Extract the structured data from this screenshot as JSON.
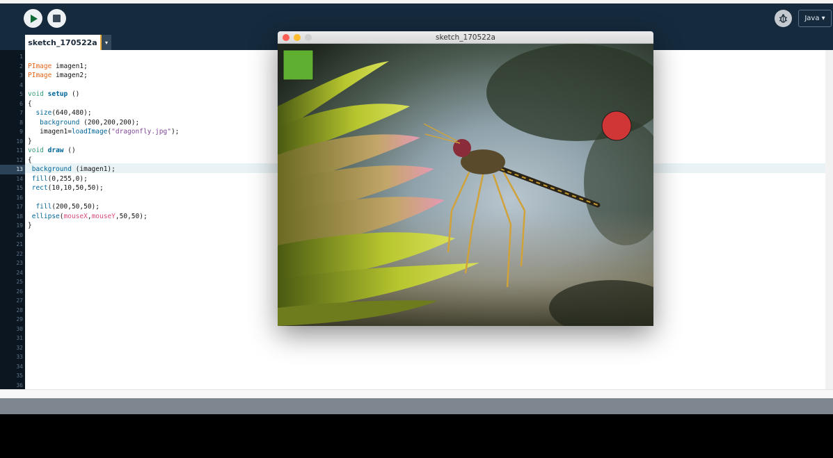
{
  "toolbar": {
    "run_label": "Run",
    "stop_label": "Stop",
    "mode": "Java ▾"
  },
  "tabs": [
    {
      "label": "sketch_170522a",
      "menu": "▾"
    }
  ],
  "gutter": {
    "active_line": 13,
    "lines": [
      "1",
      "2",
      "3",
      "4",
      "5",
      "6",
      "7",
      "8",
      "9",
      "10",
      "11",
      "12",
      "13",
      "14",
      "15",
      "16",
      "17",
      "18",
      "19",
      "20",
      "21",
      "22",
      "23",
      "24",
      "25",
      "26",
      "27",
      "28",
      "29",
      "30",
      "31",
      "32",
      "33",
      "34",
      "35",
      "36"
    ]
  },
  "code": {
    "lines": [
      "",
      "PImage imagen1;",
      "PImage imagen2;",
      "",
      "void setup ()",
      "{",
      "  size(640,480);",
      "   background (200,200,200);",
      "   imagen1=loadImage(\"dragonfly.jpg\");",
      "}",
      "void draw ()",
      "{",
      " background (imagen1);",
      " fill(0,255,0);",
      " rect(10,10,50,50);",
      "",
      "  fill(200,50,50);",
      " ellipse(mouseX,mouseY,50,50);",
      "}"
    ]
  },
  "sketch_window": {
    "title": "sketch_170522a",
    "rect_color": "#5fb030",
    "ellipse_color": "#d03636"
  },
  "icons": [
    "play-icon",
    "stop-icon",
    "debug-icon",
    "chevron-down-icon"
  ],
  "colors": {
    "toolbar_bg": "#152a3d",
    "gutter_bg": "#0c1621",
    "console_bg": "#000000",
    "status_bg": "#7e878f"
  }
}
